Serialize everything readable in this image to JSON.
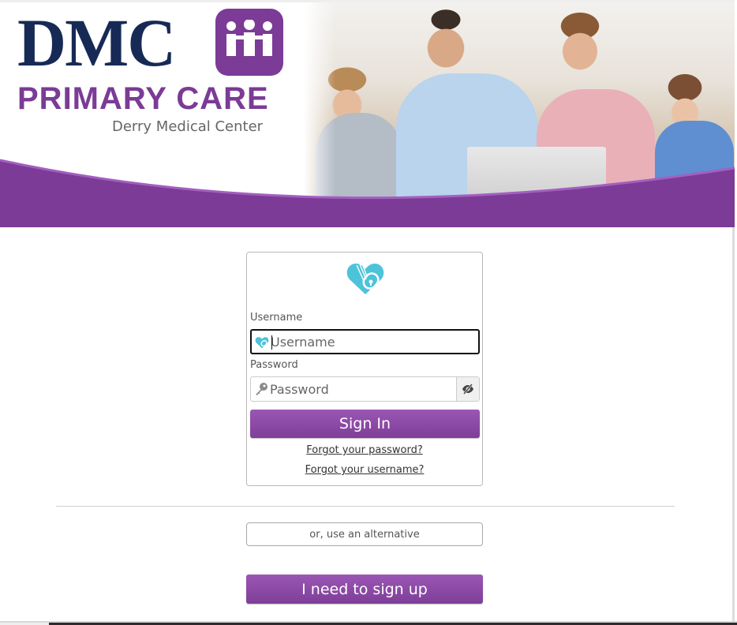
{
  "brand": {
    "logo_main": "DMC",
    "logo_line2": "PRIMARY CARE",
    "logo_subtitle": "Derry Medical Center",
    "primary_color": "#7b3b96",
    "navy_color": "#172a55",
    "accent_teal": "#4cc3d9"
  },
  "header": {
    "logo_badge_icon": "family-icon",
    "photo_alt": "family-thumbs-up-photo"
  },
  "login": {
    "card_icon": "heart-lock-icon",
    "username_label": "Username",
    "username_placeholder": "Username",
    "username_value": "",
    "username_icon": "heart-lock-icon",
    "password_label": "Password",
    "password_placeholder": "Password",
    "password_value": "",
    "password_icon": "key-icon",
    "toggle_visibility_icon": "eye-slash-icon",
    "signin_label": "Sign In",
    "forgot_password_label": "Forgot your password?",
    "forgot_username_label": "Forgot your username?"
  },
  "alternatives": {
    "alt_label": "or, use an alternative",
    "signup_label": "I need to sign up"
  }
}
